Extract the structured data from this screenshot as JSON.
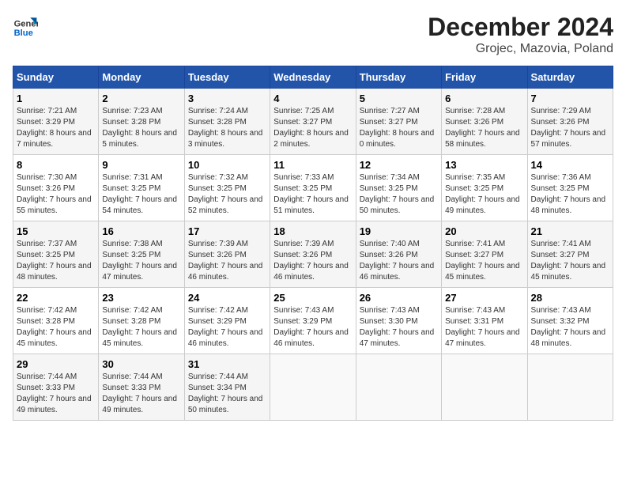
{
  "header": {
    "logo_line1": "General",
    "logo_line2": "Blue",
    "title": "December 2024",
    "subtitle": "Grojec, Mazovia, Poland"
  },
  "weekdays": [
    "Sunday",
    "Monday",
    "Tuesday",
    "Wednesday",
    "Thursday",
    "Friday",
    "Saturday"
  ],
  "weeks": [
    [
      {
        "day": "1",
        "info": "Sunrise: 7:21 AM\nSunset: 3:29 PM\nDaylight: 8 hours and 7 minutes."
      },
      {
        "day": "2",
        "info": "Sunrise: 7:23 AM\nSunset: 3:28 PM\nDaylight: 8 hours and 5 minutes."
      },
      {
        "day": "3",
        "info": "Sunrise: 7:24 AM\nSunset: 3:28 PM\nDaylight: 8 hours and 3 minutes."
      },
      {
        "day": "4",
        "info": "Sunrise: 7:25 AM\nSunset: 3:27 PM\nDaylight: 8 hours and 2 minutes."
      },
      {
        "day": "5",
        "info": "Sunrise: 7:27 AM\nSunset: 3:27 PM\nDaylight: 8 hours and 0 minutes."
      },
      {
        "day": "6",
        "info": "Sunrise: 7:28 AM\nSunset: 3:26 PM\nDaylight: 7 hours and 58 minutes."
      },
      {
        "day": "7",
        "info": "Sunrise: 7:29 AM\nSunset: 3:26 PM\nDaylight: 7 hours and 57 minutes."
      }
    ],
    [
      {
        "day": "8",
        "info": "Sunrise: 7:30 AM\nSunset: 3:26 PM\nDaylight: 7 hours and 55 minutes."
      },
      {
        "day": "9",
        "info": "Sunrise: 7:31 AM\nSunset: 3:25 PM\nDaylight: 7 hours and 54 minutes."
      },
      {
        "day": "10",
        "info": "Sunrise: 7:32 AM\nSunset: 3:25 PM\nDaylight: 7 hours and 52 minutes."
      },
      {
        "day": "11",
        "info": "Sunrise: 7:33 AM\nSunset: 3:25 PM\nDaylight: 7 hours and 51 minutes."
      },
      {
        "day": "12",
        "info": "Sunrise: 7:34 AM\nSunset: 3:25 PM\nDaylight: 7 hours and 50 minutes."
      },
      {
        "day": "13",
        "info": "Sunrise: 7:35 AM\nSunset: 3:25 PM\nDaylight: 7 hours and 49 minutes."
      },
      {
        "day": "14",
        "info": "Sunrise: 7:36 AM\nSunset: 3:25 PM\nDaylight: 7 hours and 48 minutes."
      }
    ],
    [
      {
        "day": "15",
        "info": "Sunrise: 7:37 AM\nSunset: 3:25 PM\nDaylight: 7 hours and 48 minutes."
      },
      {
        "day": "16",
        "info": "Sunrise: 7:38 AM\nSunset: 3:25 PM\nDaylight: 7 hours and 47 minutes."
      },
      {
        "day": "17",
        "info": "Sunrise: 7:39 AM\nSunset: 3:26 PM\nDaylight: 7 hours and 46 minutes."
      },
      {
        "day": "18",
        "info": "Sunrise: 7:39 AM\nSunset: 3:26 PM\nDaylight: 7 hours and 46 minutes."
      },
      {
        "day": "19",
        "info": "Sunrise: 7:40 AM\nSunset: 3:26 PM\nDaylight: 7 hours and 46 minutes."
      },
      {
        "day": "20",
        "info": "Sunrise: 7:41 AM\nSunset: 3:27 PM\nDaylight: 7 hours and 45 minutes."
      },
      {
        "day": "21",
        "info": "Sunrise: 7:41 AM\nSunset: 3:27 PM\nDaylight: 7 hours and 45 minutes."
      }
    ],
    [
      {
        "day": "22",
        "info": "Sunrise: 7:42 AM\nSunset: 3:28 PM\nDaylight: 7 hours and 45 minutes."
      },
      {
        "day": "23",
        "info": "Sunrise: 7:42 AM\nSunset: 3:28 PM\nDaylight: 7 hours and 45 minutes."
      },
      {
        "day": "24",
        "info": "Sunrise: 7:42 AM\nSunset: 3:29 PM\nDaylight: 7 hours and 46 minutes."
      },
      {
        "day": "25",
        "info": "Sunrise: 7:43 AM\nSunset: 3:29 PM\nDaylight: 7 hours and 46 minutes."
      },
      {
        "day": "26",
        "info": "Sunrise: 7:43 AM\nSunset: 3:30 PM\nDaylight: 7 hours and 47 minutes."
      },
      {
        "day": "27",
        "info": "Sunrise: 7:43 AM\nSunset: 3:31 PM\nDaylight: 7 hours and 47 minutes."
      },
      {
        "day": "28",
        "info": "Sunrise: 7:43 AM\nSunset: 3:32 PM\nDaylight: 7 hours and 48 minutes."
      }
    ],
    [
      {
        "day": "29",
        "info": "Sunrise: 7:44 AM\nSunset: 3:33 PM\nDaylight: 7 hours and 49 minutes."
      },
      {
        "day": "30",
        "info": "Sunrise: 7:44 AM\nSunset: 3:33 PM\nDaylight: 7 hours and 49 minutes."
      },
      {
        "day": "31",
        "info": "Sunrise: 7:44 AM\nSunset: 3:34 PM\nDaylight: 7 hours and 50 minutes."
      },
      {
        "day": "",
        "info": ""
      },
      {
        "day": "",
        "info": ""
      },
      {
        "day": "",
        "info": ""
      },
      {
        "day": "",
        "info": ""
      }
    ]
  ]
}
